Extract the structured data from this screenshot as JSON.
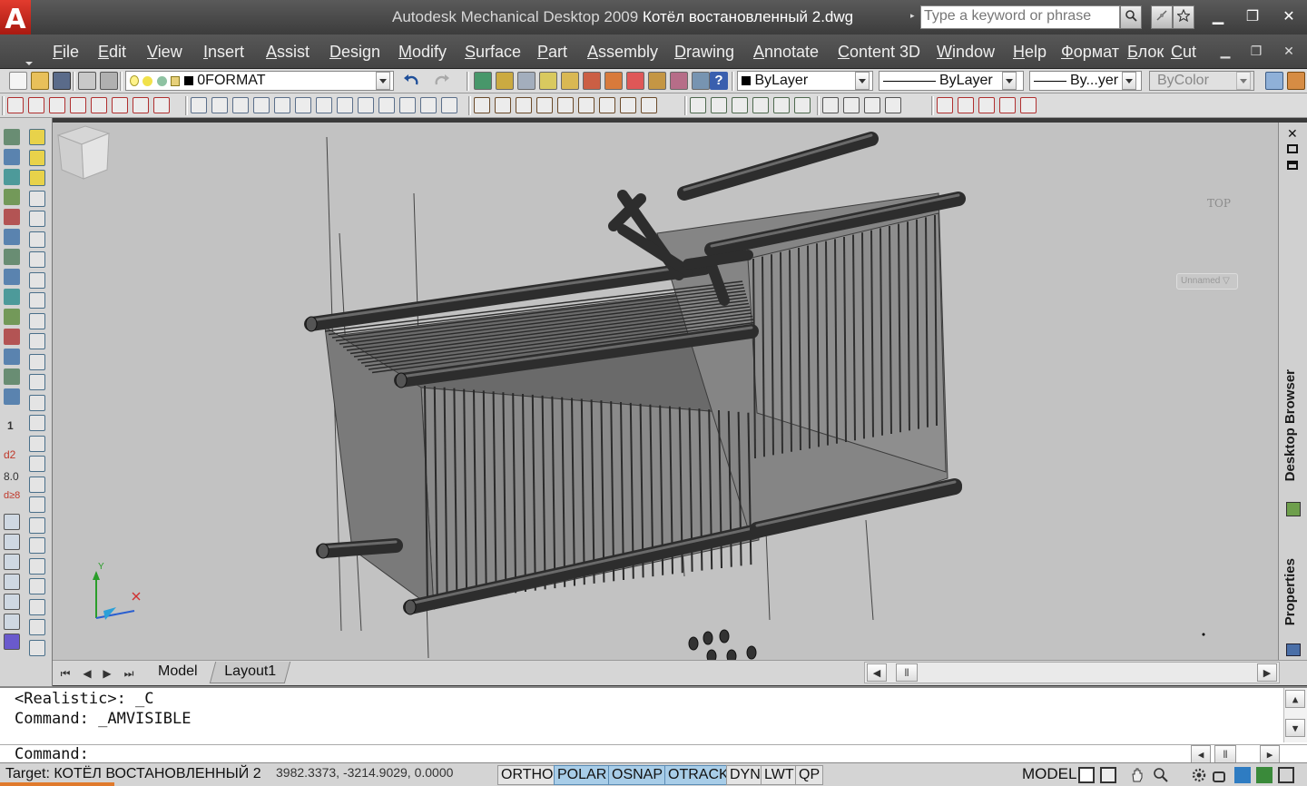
{
  "app": {
    "logo_glyph": "A",
    "title_prefix": "Autodesk Mechanical Desktop 2009",
    "title_file": "Котёл востановленный 2.dwg",
    "search_placeholder": "Type a keyword or phrase",
    "search_arrow": "▸",
    "window_min": "▁",
    "window_restore": "❐",
    "window_close": "✕"
  },
  "menu": {
    "items": [
      "File",
      "Edit",
      "View",
      "Insert",
      "Assist",
      "Design",
      "Modify",
      "Surface",
      "Part",
      "Assembly",
      "Drawing",
      "Annotate",
      "Content 3D",
      "Window",
      "Help",
      "Формат",
      "Блок",
      "Cut"
    ],
    "doc_min": "▁",
    "doc_restore": "❐",
    "doc_close": "✕"
  },
  "toolbar": {
    "layer_name": "0FORMAT",
    "color_value": "ByLayer",
    "linetype_value": "ByLayer",
    "lineweight_value": "By...yer",
    "plotstyle_value": "ByColor",
    "help_glyph": "?"
  },
  "viewport": {
    "viewcube_label": "TOP",
    "named_view": "Unnamed",
    "ucs_x": "X",
    "ucs_y": "Y",
    "bg_color": "#c2c2c2",
    "model_color": "#3c3c3c"
  },
  "right_panel": {
    "tab_1": "Desktop Browser",
    "tab_2": "Properties"
  },
  "left_palette": {
    "label_d2": "d2",
    "label_80": "8.0",
    "label_d8": "d≥8",
    "label_1": "1"
  },
  "layout_tabs": {
    "model": "Model",
    "layout1": "Layout1"
  },
  "command": {
    "history": [
      "<Realistic>: _C",
      "Command: _AMVISIBLE"
    ],
    "prompt": "Command:"
  },
  "status": {
    "target_label": "Target: КОТЁЛ ВОСТАНОВЛЕННЫЙ 2",
    "coordinates": "3982.3373, -3214.9029, 0.0000",
    "toggles": [
      {
        "label": "ORTHO",
        "on": false
      },
      {
        "label": "POLAR",
        "on": true
      },
      {
        "label": "OSNAP",
        "on": true
      },
      {
        "label": "OTRACK",
        "on": true
      },
      {
        "label": "DYN",
        "on": false
      },
      {
        "label": "LWT",
        "on": false
      },
      {
        "label": "QP",
        "on": false
      }
    ],
    "space": "MODEL"
  }
}
